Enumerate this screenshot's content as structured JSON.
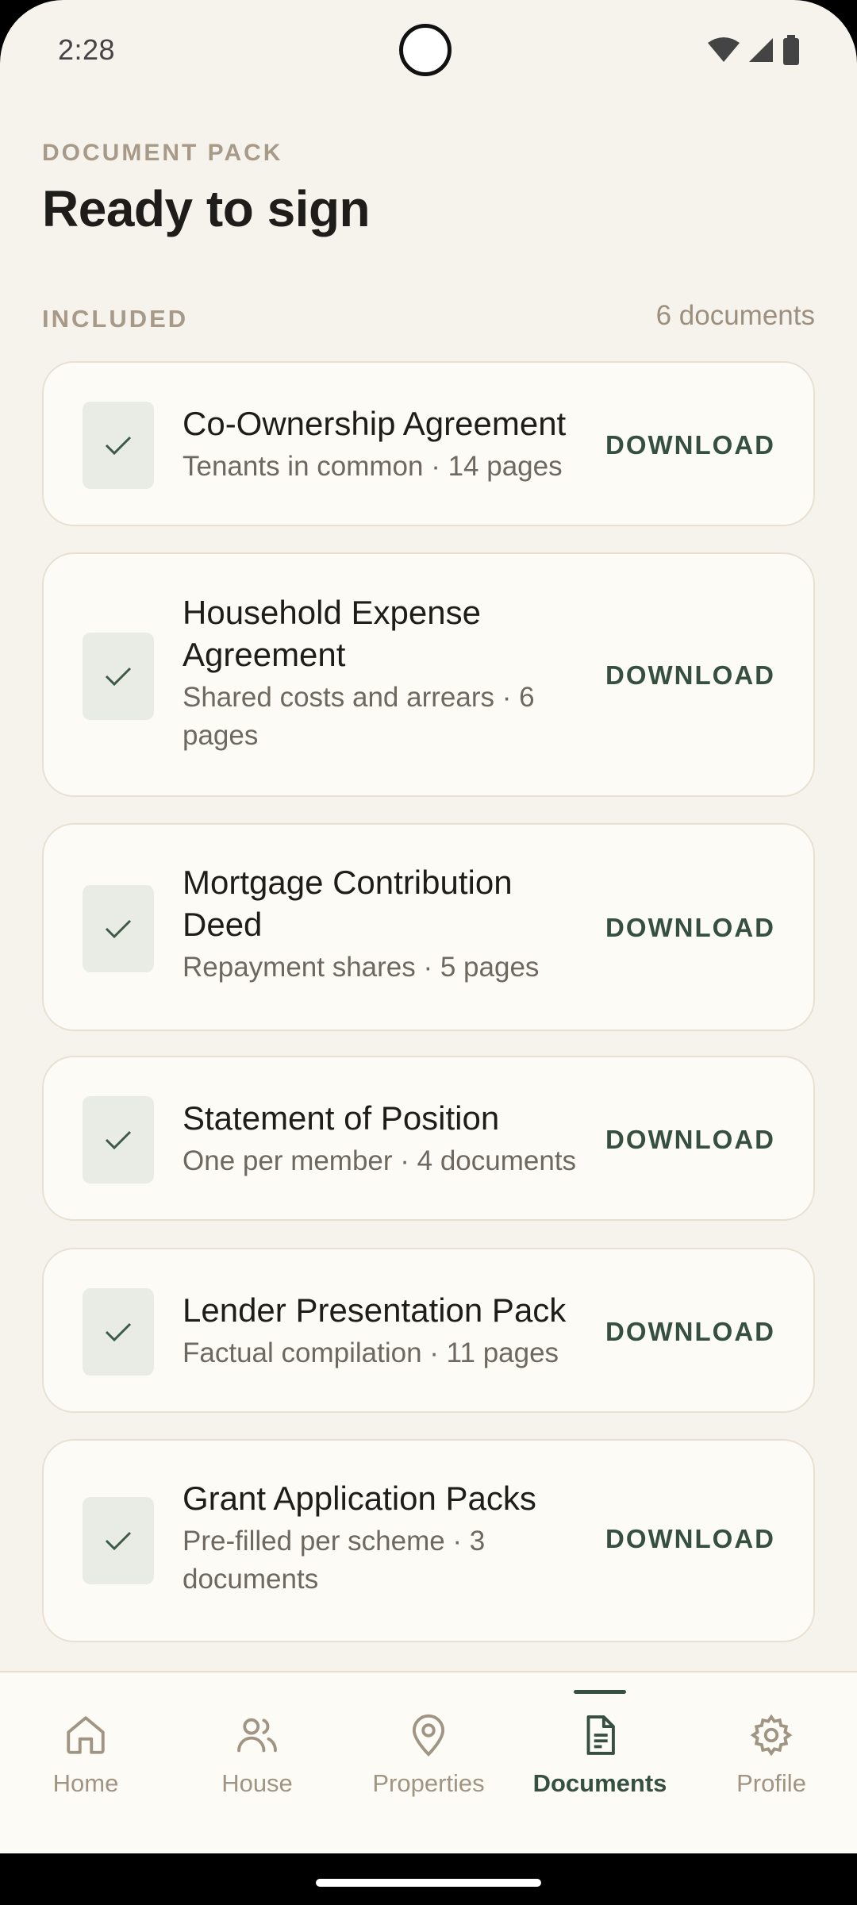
{
  "status": {
    "time": "2:28"
  },
  "header": {
    "eyebrow": "DOCUMENT PACK",
    "title": "Ready to sign"
  },
  "section": {
    "label": "INCLUDED",
    "count": "6 documents"
  },
  "download_label": "DOWNLOAD",
  "documents": [
    {
      "title": "Co-Ownership Agreement",
      "subtitle": "Tenants in common · 14 pages"
    },
    {
      "title": "Household Expense Agreement",
      "subtitle": "Shared costs and arrears · 6 pages"
    },
    {
      "title": "Mortgage Contribution Deed",
      "subtitle": "Repayment shares · 5 pages"
    },
    {
      "title": "Statement of Position",
      "subtitle": "One per member · 4 documents"
    },
    {
      "title": "Lender Presentation Pack",
      "subtitle": "Factual compilation · 11 pages"
    },
    {
      "title": "Grant Application Packs",
      "subtitle": "Pre-filled per scheme · 3 documents"
    }
  ],
  "nav": {
    "items": [
      {
        "label": "Home",
        "icon": "home-icon"
      },
      {
        "label": "House",
        "icon": "people-icon"
      },
      {
        "label": "Properties",
        "icon": "location-pin-icon"
      },
      {
        "label": "Documents",
        "icon": "document-icon",
        "active": true
      },
      {
        "label": "Profile",
        "icon": "gear-icon"
      }
    ]
  },
  "colors": {
    "accent": "#35503f",
    "background": "#f6f3ec",
    "card": "#fdfbf6",
    "muted": "#a89a88"
  }
}
